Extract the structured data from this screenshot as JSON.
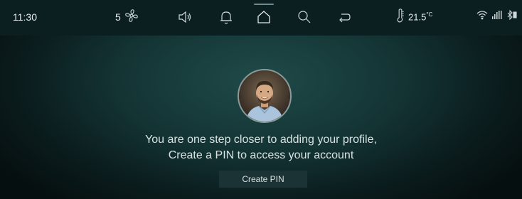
{
  "status_bar": {
    "time": "11:30",
    "fan_speed": "5",
    "temperature": "21.5",
    "temperature_unit": "°C",
    "icons": [
      "fan-icon",
      "volume-icon",
      "bell-icon",
      "home-icon",
      "search-icon",
      "return-icon",
      "thermometer-icon",
      "wifi-icon",
      "signal-icon",
      "bluetooth-icon"
    ]
  },
  "main": {
    "avatar_icon": "profile-photo",
    "message_line1": "You are one step closer to adding your profile,",
    "message_line2": "Create a PIN to access your account",
    "create_pin_label": "Create PIN"
  }
}
